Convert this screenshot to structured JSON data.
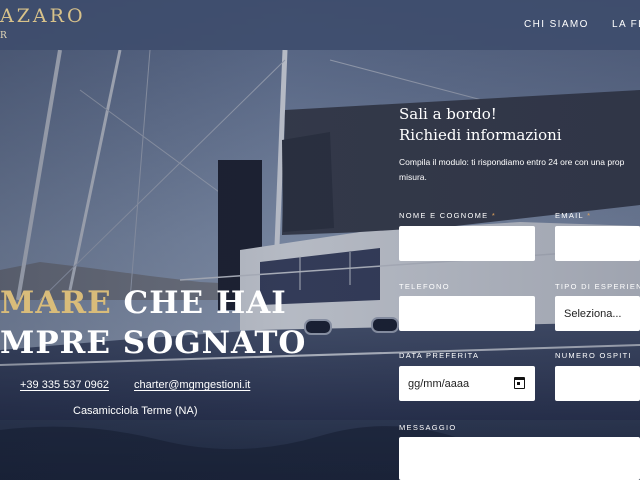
{
  "nav": {
    "brand": "AZARO",
    "brand_sub": "R",
    "links": [
      "CHI SIAMO",
      "LA FL"
    ]
  },
  "hero": {
    "title_accent": "MARE",
    "title_rest_1": " CHE HAI",
    "title_line_2": "MPRE SOGNATO",
    "phone": "+39 335 537 0962",
    "email": "charter@mgmgestioni.it",
    "address": "Casamicciola Terme (NA)"
  },
  "form": {
    "title_line_1": "Sali a bordo!",
    "title_line_2": "Richiedi informazioni",
    "intro_line_1": "Compila il modulo: ti rispondiamo entro 24 ore con una prop",
    "intro_line_2": "misura.",
    "required_mark": "*",
    "labels": {
      "name": "NOME E COGNOME",
      "email": "EMAIL",
      "phone": "TELEFONO",
      "experience": "TIPO DI ESPERIENZA",
      "date": "DATA PREFERITA",
      "guests": "NUMERO OSPITI",
      "message": "MESSAGGIO"
    },
    "values": {
      "name": "",
      "email": "",
      "phone": "",
      "experience": "Seleziona...",
      "date": "gg/mm/aaaa",
      "guests": "",
      "message": ""
    }
  },
  "colors": {
    "navbar": "#3e4c6c",
    "brand_gold": "#d8c28a",
    "accent_gold": "#d9bc7a",
    "required_orange": "#e0a15a"
  }
}
